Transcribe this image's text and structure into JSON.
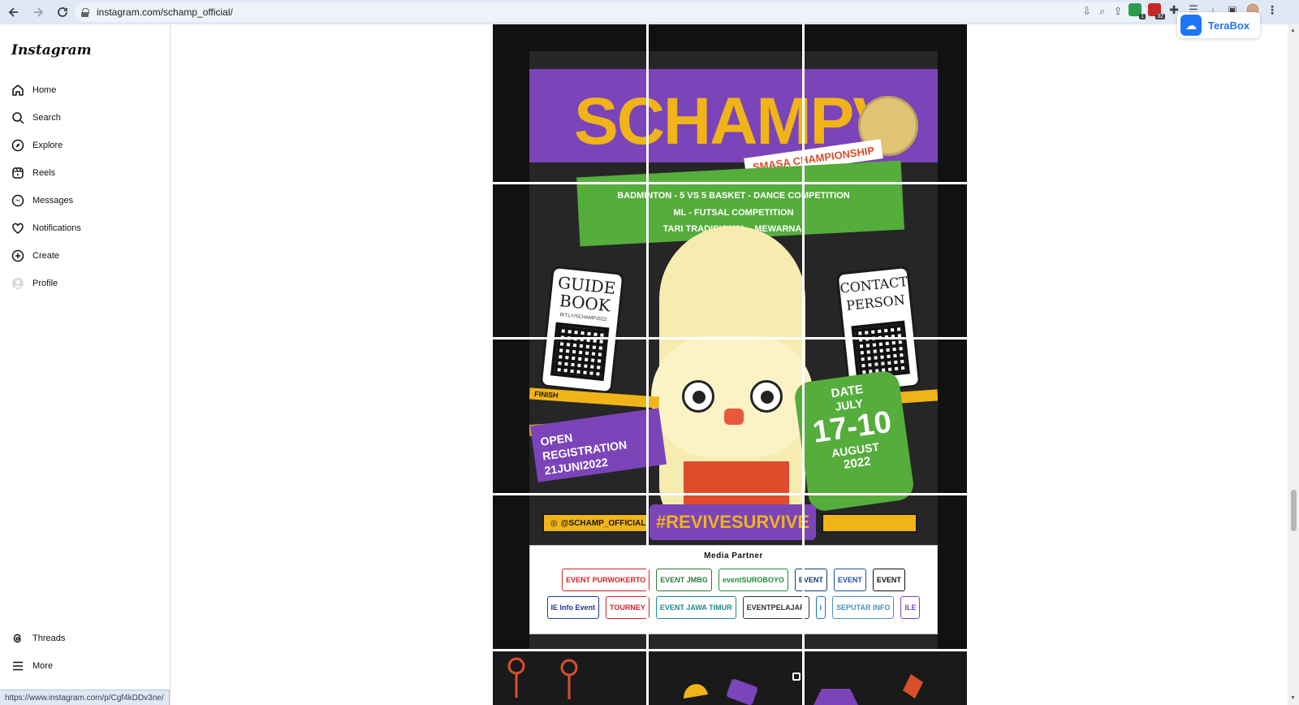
{
  "browser": {
    "url": "instagram.com/schamp_official/",
    "ext_badge_1": "1",
    "ext_badge_2": "32",
    "terabox_label": "TeraBox",
    "status_url": "https://www.instagram.com/p/Cgf4kDDv3ne/"
  },
  "sidebar": {
    "logo": "Instagram",
    "items": [
      {
        "label": "Home",
        "icon": "home-icon"
      },
      {
        "label": "Search",
        "icon": "search-icon"
      },
      {
        "label": "Explore",
        "icon": "compass-icon"
      },
      {
        "label": "Reels",
        "icon": "reels-icon"
      },
      {
        "label": "Messages",
        "icon": "messenger-icon"
      },
      {
        "label": "Notifications",
        "icon": "heart-icon"
      },
      {
        "label": "Create",
        "icon": "plus-square-icon"
      },
      {
        "label": "Profile",
        "icon": "avatar-icon"
      }
    ],
    "bottom_items": [
      {
        "label": "Threads",
        "icon": "threads-icon"
      },
      {
        "label": "More",
        "icon": "menu-icon"
      }
    ]
  },
  "poster": {
    "title": "SCHAMP",
    "roman": "V",
    "subtitle": "SMASA CHAMPIONSHIP",
    "sports_line1": "BADMINTON - 5 VS 5 BASKET - DANCE COMPETITION",
    "sports_line2": "ML - FUTSAL COMPETITION",
    "sports_line3": "TARI TRADISIONAL - MEWARNAI",
    "guide_title": "GUIDE BOOK",
    "guide_link": "BIT.LY/SCHAMP2022",
    "contact_title": "CONTACT PERSON",
    "finish_label": "FINISH",
    "registration": "OPEN REGISTRATION",
    "registration_date": "21JUNI2022",
    "date_label": "DATE",
    "date_days": "17-10",
    "date_month1": "JULY",
    "date_month2": "AUGUST",
    "date_year": "2022",
    "handle": "@SCHAMP_OFFICIAL",
    "hashtag": "#REVIVESURVIVE",
    "media_partner_title": "Media Partner",
    "partners": [
      {
        "name": "EVENT PURWOKERTO",
        "color": "#d2232a"
      },
      {
        "name": "EVENT JMBG",
        "color": "#2b7a3b"
      },
      {
        "name": "eventSUROBOYO",
        "color": "#1e8e3e"
      },
      {
        "name": "EVENT",
        "color": "#143b6b"
      },
      {
        "name": "EVENT",
        "color": "#1d4f9b"
      },
      {
        "name": "EVENT",
        "color": "#111111"
      },
      {
        "name": "IE Info Event",
        "color": "#1f3a93"
      },
      {
        "name": "TOURNEY",
        "color": "#d2232a"
      },
      {
        "name": "EVENT JAWA TIMUR",
        "color": "#1c8a8a"
      },
      {
        "name": "EVENTPELAJAR",
        "color": "#333333"
      },
      {
        "name": "i",
        "color": "#1b73b8"
      },
      {
        "name": "SEPUTAR INFO",
        "color": "#4a90c2"
      },
      {
        "name": "ILE",
        "color": "#7b44b9"
      }
    ]
  },
  "colors": {
    "purple": "#7b44b9",
    "yellow": "#f0b418",
    "green": "#55ad3c",
    "orange": "#e04b2c"
  }
}
